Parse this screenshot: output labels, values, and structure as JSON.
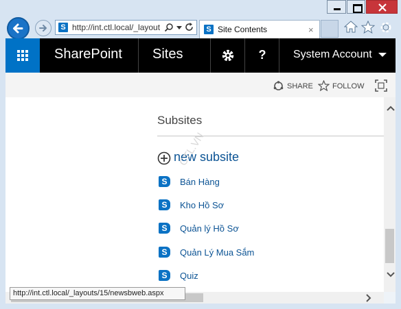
{
  "browser": {
    "address": "http://int.ctl.local/_layouts",
    "tab_title": "Site Contents",
    "tab_close": "×",
    "status_url": "http://int.ctl.local/_layouts/15/newsbweb.aspx"
  },
  "icons": {
    "sharepoint_glyph": "S",
    "help_glyph": "?"
  },
  "suitebar": {
    "brand": "SharePoint",
    "sites": "Sites",
    "account": "System Account"
  },
  "actions": {
    "share": "SHARE",
    "follow": "FOLLOW"
  },
  "page": {
    "section_title": "Subsites",
    "new_subsite": "new subsite",
    "watermark": "CTL.VN",
    "subsites": [
      {
        "label": "Bán Hàng"
      },
      {
        "label": "Kho Hồ Sơ"
      },
      {
        "label": "Quản lý Hồ Sơ"
      },
      {
        "label": "Quản Lý Mua Sắm"
      },
      {
        "label": "Quiz"
      }
    ]
  },
  "colors": {
    "suitebar_bg": "#000000",
    "launcher_bg": "#0072c6",
    "link_blue": "#0b5394",
    "sharepoint_blue": "#0b72c4"
  }
}
